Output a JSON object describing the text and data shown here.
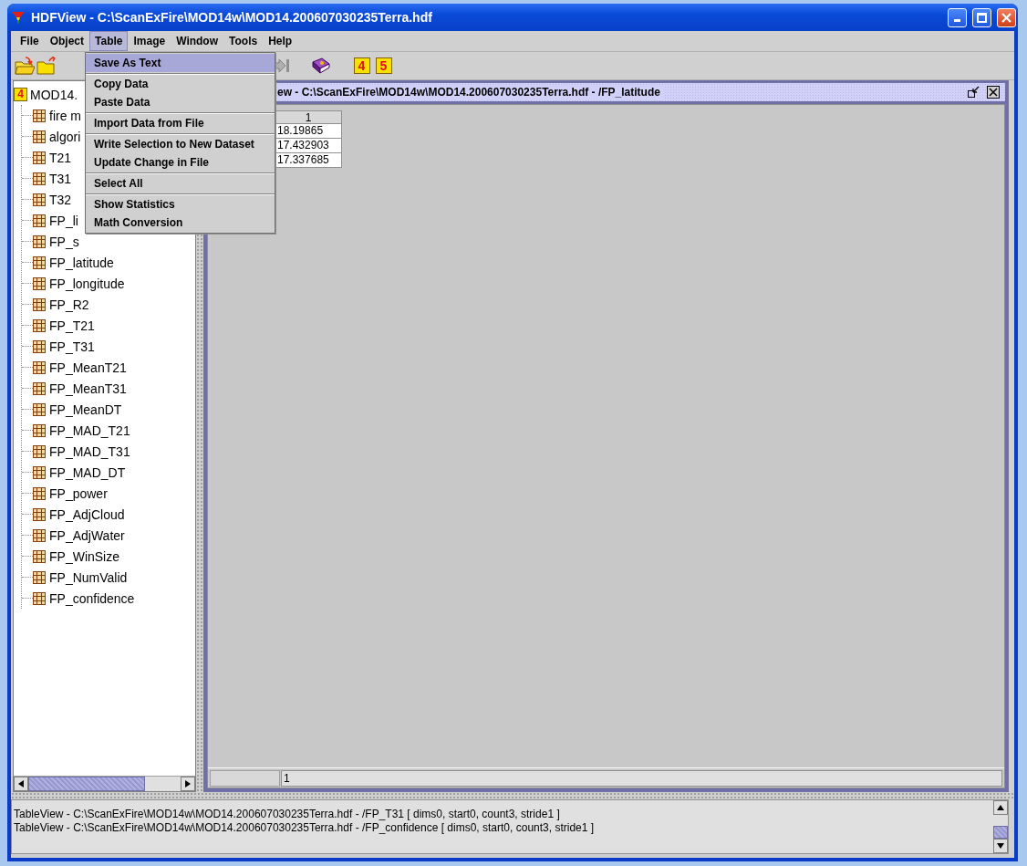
{
  "window": {
    "title": "HDFView - C:\\ScanExFire\\MOD14w\\MOD14.200607030235Terra.hdf"
  },
  "menubar": [
    {
      "label": "File",
      "selected": false
    },
    {
      "label": "Object",
      "selected": false
    },
    {
      "label": "Table",
      "selected": true
    },
    {
      "label": "Image",
      "selected": false
    },
    {
      "label": "Window",
      "selected": false
    },
    {
      "label": "Tools",
      "selected": false
    },
    {
      "label": "Help",
      "selected": false
    }
  ],
  "toolbar": [
    {
      "kind": "open"
    },
    {
      "kind": "new"
    },
    {
      "kind": "last"
    },
    {
      "kind": "book"
    },
    {
      "kind": "badge",
      "label": "4"
    },
    {
      "kind": "badge",
      "label": "5"
    }
  ],
  "tree": {
    "root": {
      "label": "MOD14.",
      "badge": "4"
    },
    "children": [
      {
        "label": "fire m"
      },
      {
        "label": "algori"
      },
      {
        "label": "T21"
      },
      {
        "label": "T31"
      },
      {
        "label": "T32"
      },
      {
        "label": "FP_li"
      },
      {
        "label": "FP_s"
      },
      {
        "label": "FP_latitude"
      },
      {
        "label": "FP_longitude"
      },
      {
        "label": "FP_R2"
      },
      {
        "label": "FP_T21"
      },
      {
        "label": "FP_T31"
      },
      {
        "label": "FP_MeanT21"
      },
      {
        "label": "FP_MeanT31"
      },
      {
        "label": "FP_MeanDT"
      },
      {
        "label": "FP_MAD_T21"
      },
      {
        "label": "FP_MAD_T31"
      },
      {
        "label": "FP_MAD_DT"
      },
      {
        "label": "FP_power"
      },
      {
        "label": "FP_AdjCloud"
      },
      {
        "label": "FP_AdjWater"
      },
      {
        "label": "FP_WinSize"
      },
      {
        "label": "FP_NumValid"
      },
      {
        "label": "FP_confidence"
      }
    ]
  },
  "menu": {
    "groups": [
      [
        {
          "label": "Save As Text",
          "selected": true
        }
      ],
      [
        {
          "label": "Copy Data",
          "selected": false
        },
        {
          "label": "Paste Data",
          "selected": false
        }
      ],
      [
        {
          "label": "Import Data from File",
          "selected": false
        }
      ],
      [
        {
          "label": "Write Selection to New Dataset",
          "selected": false
        },
        {
          "label": "Update Change in File",
          "selected": false
        }
      ],
      [
        {
          "label": "Select All",
          "selected": false
        }
      ],
      [
        {
          "label": "Show Statistics",
          "selected": false
        },
        {
          "label": "Math Conversion",
          "selected": false
        }
      ]
    ]
  },
  "table_view": {
    "title": "ew - C:\\ScanExFire\\MOD14w\\MOD14.200607030235Terra.hdf - /FP_latitude",
    "columns": [
      "1"
    ],
    "rows": [
      "18.19865",
      "17.432903",
      "17.337685"
    ],
    "status": "1"
  },
  "log": {
    "lines": [
      "TableView - C:\\ScanExFire\\MOD14w\\MOD14.200607030235Terra.hdf - /FP_T31 [ dims0, start0, count3, stride1 ]",
      "TableView - C:\\ScanExFire\\MOD14w\\MOD14.200607030235Terra.hdf - /FP_confidence [ dims0, start0, count3, stride1 ]"
    ]
  }
}
